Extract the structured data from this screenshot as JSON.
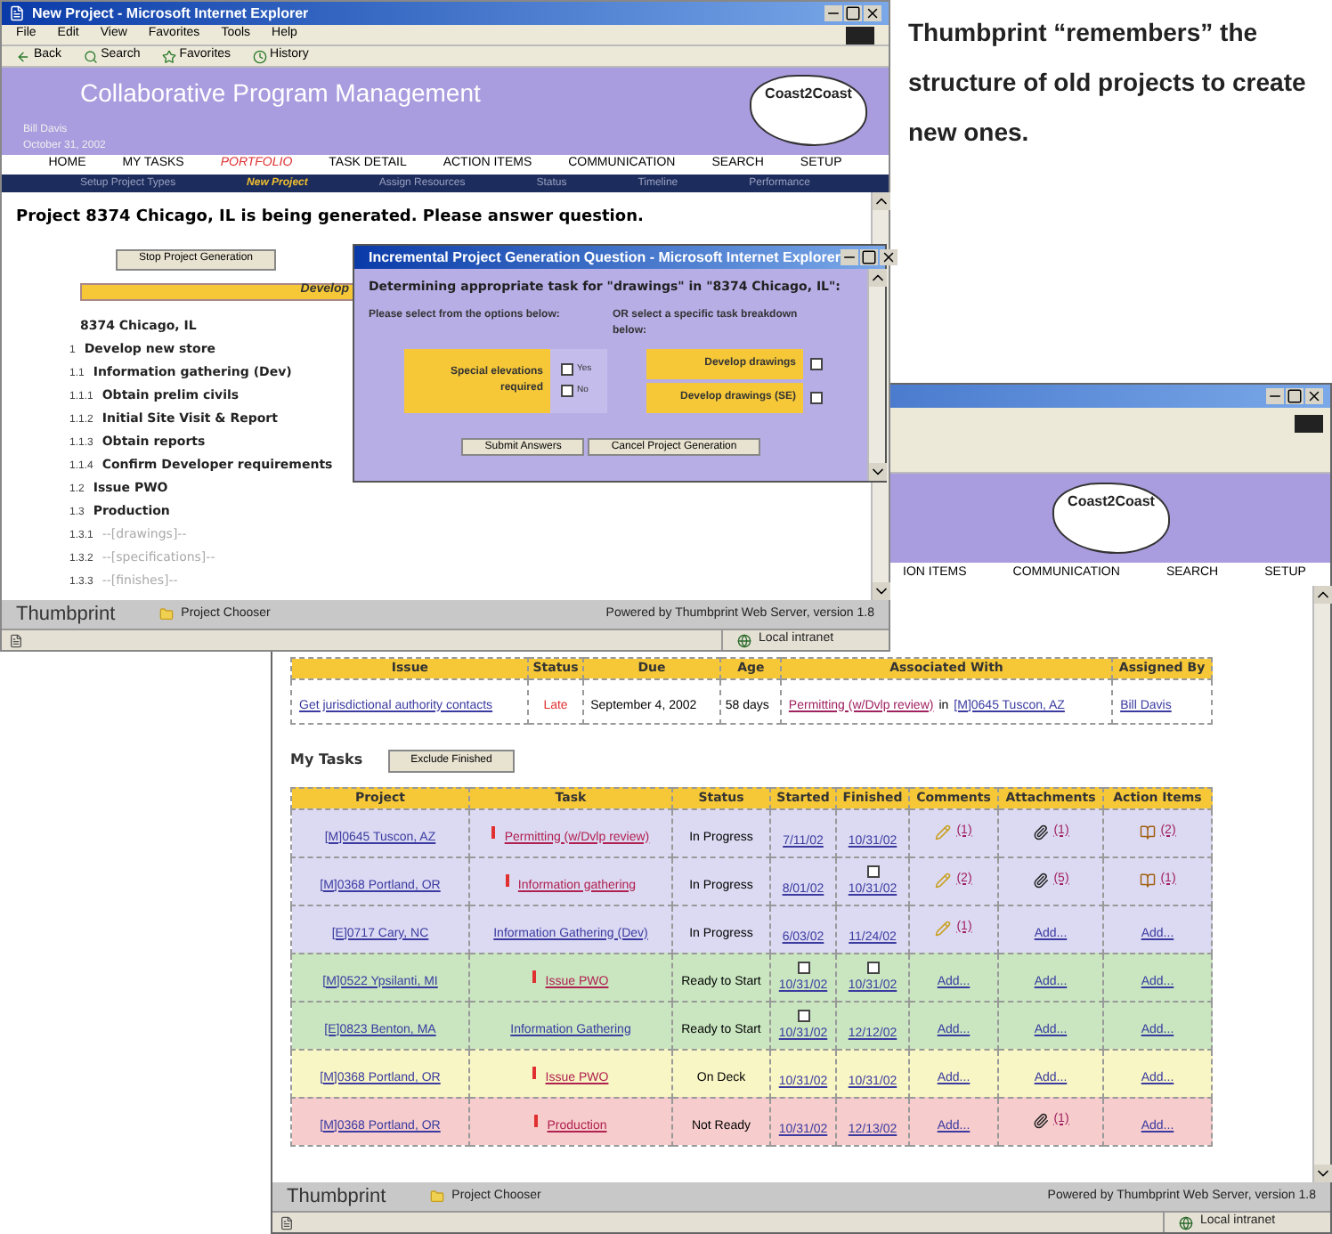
{
  "caption": "Thumbprint “remembers” the structure of old projects to create new ones.",
  "generation_window": {
    "title": "New Project - Microsoft Internet Explorer",
    "menu": [
      "File",
      "Edit",
      "View",
      "Favorites",
      "Tools",
      "Help"
    ],
    "toolbar": [
      "Back",
      "Search",
      "Favorites",
      "History"
    ],
    "app_title": "Collaborative Program Management",
    "user": "Bill Davis",
    "date": "October 31, 2002",
    "logo": "Coast2Coast",
    "nav": [
      {
        "label": "HOME",
        "selected": false
      },
      {
        "label": "MY TASKS",
        "selected": false
      },
      {
        "label": "PORTFOLIO",
        "selected": true
      },
      {
        "label": "TASK DETAIL",
        "selected": false
      },
      {
        "label": "ACTION ITEMS",
        "selected": false
      },
      {
        "label": "COMMUNICATION",
        "selected": false
      },
      {
        "label": "SEARCH",
        "selected": false
      },
      {
        "label": "SETUP",
        "selected": false
      }
    ],
    "subnav": [
      {
        "label": "Setup Project Types",
        "selected": false
      },
      {
        "label": "New Project",
        "selected": true
      },
      {
        "label": "Assign Resources",
        "selected": false
      },
      {
        "label": "Status",
        "selected": false
      },
      {
        "label": "Timeline",
        "selected": false
      },
      {
        "label": "Performance",
        "selected": false
      }
    ],
    "message": "Project 8374 Chicago, IL is being generated. Please answer question.",
    "stop_button": "Stop Project Generation",
    "banner": "Develop",
    "tree": {
      "label": "8374 Chicago, IL",
      "children": [
        {
          "number": "1",
          "label": "Develop new store",
          "pending": false,
          "children": [
            {
              "number": "1.1",
              "label": "Information gathering (Dev)",
              "pending": false,
              "children": [
                {
                  "number": "1.1.1",
                  "label": "Obtain prelim civils",
                  "pending": false
                },
                {
                  "number": "1.1.2",
                  "label": "Initial Site Visit & Report",
                  "pending": false
                },
                {
                  "number": "1.1.3",
                  "label": "Obtain reports",
                  "pending": false
                },
                {
                  "number": "1.1.4",
                  "label": "Confirm Developer requirements",
                  "pending": false
                }
              ]
            },
            {
              "number": "1.2",
              "label": "Issue PWO",
              "pending": false
            },
            {
              "number": "1.3",
              "label": "Production",
              "pending": false,
              "children": [
                {
                  "number": "1.3.1",
                  "label": "--[drawings]--",
                  "pending": true
                },
                {
                  "number": "1.3.2",
                  "label": "--[specifications]--",
                  "pending": true
                },
                {
                  "number": "1.3.3",
                  "label": "--[finishes]--",
                  "pending": true
                }
              ]
            }
          ]
        }
      ]
    },
    "footer": {
      "logo": "**Thumb**print",
      "chooser": "Project Chooser",
      "powered": "Powered by Thumbprint Web Server, version 1.8"
    },
    "status": "Local intranet"
  },
  "question_dialog": {
    "title": "Incremental Project Generation Question - Microsoft Internet Explorer",
    "question": "Determining appropriate task for \"drawings\" in \"8374 Chicago, IL\":",
    "left_prompt": "Please select from the options below:",
    "right_prompt": "OR select a specific task breakdown below:",
    "option": {
      "label": "Special elevations required",
      "choices": [
        {
          "label": "Yes",
          "checked": false
        },
        {
          "label": "No",
          "checked": false
        }
      ]
    },
    "tasks": [
      {
        "label": "Develop drawings",
        "checked": false
      },
      {
        "label": "Develop drawings (SE)",
        "checked": false
      }
    ],
    "buttons": [
      "Submit Answers",
      "Cancel Project Generation"
    ]
  },
  "tasks_window": {
    "logo": "Coast2Coast",
    "nav": [
      "ION ITEMS",
      "COMMUNICATION",
      "SEARCH",
      "SETUP"
    ],
    "issues": {
      "columns": [
        "Issue",
        "Status",
        "Due",
        "Age",
        "Associated With",
        "Assigned By"
      ],
      "rows": [
        {
          "issue": "Get jurisdictional authority contacts",
          "status": "Late",
          "due": "September 4, 2002",
          "age": "58 days",
          "task": "Permitting (w/Dvlp review)",
          "joiner": "in",
          "project": "[M]0645 Tuscon, AZ",
          "assigned_by": "Bill Davis"
        }
      ]
    },
    "my_tasks": "My Tasks",
    "exclude_button": "Exclude Finished",
    "tasks": {
      "columns": [
        "Project",
        "Task",
        "Status",
        "Started",
        "Finished",
        "Comments",
        "Attachments",
        "Action Items"
      ],
      "rows": [
        {
          "color": "#dcdaf2",
          "project": "[M]0645 Tuscon, AZ",
          "urgent": true,
          "task": "Permitting (w/Dvlp review)",
          "status": "In Progress",
          "started": {
            "date": "7/11/02"
          },
          "finished": {
            "date": "10/31/02"
          },
          "comments": {
            "kind": "count",
            "text": "(1)"
          },
          "attachments": {
            "kind": "count",
            "text": "(1)"
          },
          "action_items": {
            "kind": "count",
            "text": "(2)"
          }
        },
        {
          "color": "#dcdaf2",
          "project": "[M]0368 Portland, OR",
          "urgent": true,
          "task": "Information gathering",
          "status": "In Progress",
          "started": {
            "date": "8/01/02"
          },
          "finished": {
            "date": "10/31/02",
            "box": {
              "checked": false
            }
          },
          "comments": {
            "kind": "count",
            "text": "(2)"
          },
          "attachments": {
            "kind": "count",
            "text": "(5)"
          },
          "action_items": {
            "kind": "count",
            "text": "(1)"
          }
        },
        {
          "color": "#dcdaf2",
          "project": "[E]0717 Cary, NC",
          "urgent": false,
          "task": "Information Gathering (Dev)",
          "status": "In Progress",
          "started": {
            "date": "6/03/02"
          },
          "finished": {
            "date": "11/24/02"
          },
          "comments": {
            "kind": "count",
            "text": "(1)"
          },
          "attachments": {
            "kind": "add",
            "text": "Add..."
          },
          "action_items": {
            "kind": "add",
            "text": "Add..."
          }
        },
        {
          "color": "#c9e6c0",
          "project": "[M]0522 Ypsilanti, MI",
          "urgent": true,
          "task": "Issue PWO",
          "status": "Ready to Start",
          "started": {
            "date": "10/31/02",
            "box": {
              "checked": false
            }
          },
          "finished": {
            "date": "10/31/02",
            "box": {
              "checked": false
            }
          },
          "comments": {
            "kind": "add",
            "text": "Add..."
          },
          "attachments": {
            "kind": "add",
            "text": "Add..."
          },
          "action_items": {
            "kind": "add",
            "text": "Add..."
          }
        },
        {
          "color": "#c9e6c0",
          "project": "[E]0823 Benton, MA",
          "urgent": false,
          "task": "Information Gathering",
          "status": "Ready to Start",
          "started": {
            "date": "10/31/02",
            "box": {
              "checked": false
            }
          },
          "finished": {
            "date": "12/12/02"
          },
          "comments": {
            "kind": "add",
            "text": "Add..."
          },
          "attachments": {
            "kind": "add",
            "text": "Add..."
          },
          "action_items": {
            "kind": "add",
            "text": "Add..."
          }
        },
        {
          "color": "#f8f6c4",
          "project": "[M]0368 Portland, OR",
          "urgent": true,
          "task": "Issue PWO",
          "status": "On Deck",
          "started": {
            "date": "10/31/02"
          },
          "finished": {
            "date": "10/31/02"
          },
          "comments": {
            "kind": "add",
            "text": "Add..."
          },
          "attachments": {
            "kind": "add",
            "text": "Add..."
          },
          "action_items": {
            "kind": "add",
            "text": "Add..."
          }
        },
        {
          "color": "#f6cccc",
          "project": "[M]0368 Portland, OR",
          "urgent": true,
          "task": "Production",
          "status": "Not Ready",
          "started": {
            "date": "10/31/02"
          },
          "finished": {
            "date": "12/13/02"
          },
          "comments": {
            "kind": "add",
            "text": "Add..."
          },
          "attachments": {
            "kind": "count",
            "text": "(1)"
          },
          "action_items": {
            "kind": "add",
            "text": "Add..."
          }
        }
      ]
    },
    "footer": {
      "logo": "**Thumb**print",
      "chooser": "Project Chooser",
      "powered": "Powered by Thumbprint Web Server, version 1.8"
    },
    "status": "Local intranet"
  }
}
